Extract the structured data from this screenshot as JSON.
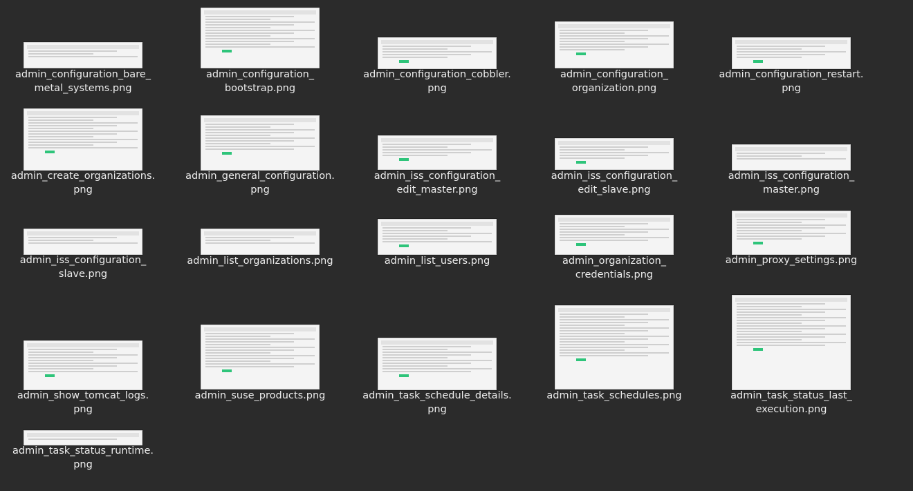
{
  "files": [
    {
      "name": "admin_configuration_bare_metal_systems.png",
      "label_lines": [
        "admin_configuration_bare_",
        "metal_systems.png"
      ]
    },
    {
      "name": "admin_configuration_bootstrap.png",
      "label_lines": [
        "admin_configuration_",
        "bootstrap.png"
      ]
    },
    {
      "name": "admin_configuration_cobbler.png",
      "label_lines": [
        "admin_configuration_cobbler.",
        "png"
      ]
    },
    {
      "name": "admin_configuration_organization.png",
      "label_lines": [
        "admin_configuration_",
        "organization.png"
      ]
    },
    {
      "name": "admin_configuration_restart.png",
      "label_lines": [
        "admin_configuration_restart.",
        "png"
      ]
    },
    {
      "name": "admin_create_organizations.png",
      "label_lines": [
        "admin_create_organizations.",
        "png"
      ]
    },
    {
      "name": "admin_general_configuration.png",
      "label_lines": [
        "admin_general_configuration.",
        "png"
      ]
    },
    {
      "name": "admin_iss_configuration_edit_master.png",
      "label_lines": [
        "admin_iss_configuration_",
        "edit_master.png"
      ]
    },
    {
      "name": "admin_iss_configuration_edit_slave.png",
      "label_lines": [
        "admin_iss_configuration_",
        "edit_slave.png"
      ]
    },
    {
      "name": "admin_iss_configuration_master.png",
      "label_lines": [
        "admin_iss_configuration_",
        "master.png"
      ]
    },
    {
      "name": "admin_iss_configuration_slave.png",
      "label_lines": [
        "admin_iss_configuration_",
        "slave.png"
      ]
    },
    {
      "name": "admin_list_organizations.png",
      "label_lines": [
        "admin_list_organizations.png"
      ]
    },
    {
      "name": "admin_list_users.png",
      "label_lines": [
        "admin_list_users.png"
      ]
    },
    {
      "name": "admin_organization_credentials.png",
      "label_lines": [
        "admin_organization_",
        "credentials.png"
      ]
    },
    {
      "name": "admin_proxy_settings.png",
      "label_lines": [
        "admin_proxy_settings.png"
      ]
    },
    {
      "name": "admin_show_tomcat_logs.png",
      "label_lines": [
        "admin_show_tomcat_logs.",
        "png"
      ]
    },
    {
      "name": "admin_suse_products.png",
      "label_lines": [
        "admin_suse_products.png"
      ]
    },
    {
      "name": "admin_task_schedule_details.png",
      "label_lines": [
        "admin_task_schedule_details.",
        "png"
      ]
    },
    {
      "name": "admin_task_schedules.png",
      "label_lines": [
        "admin_task_schedules.png"
      ]
    },
    {
      "name": "admin_task_status_last_execution.png",
      "label_lines": [
        "admin_task_status_last_",
        "execution.png"
      ]
    },
    {
      "name": "admin_task_status_runtime.png",
      "label_lines": [
        "admin_task_status_runtime.",
        "png"
      ]
    }
  ]
}
